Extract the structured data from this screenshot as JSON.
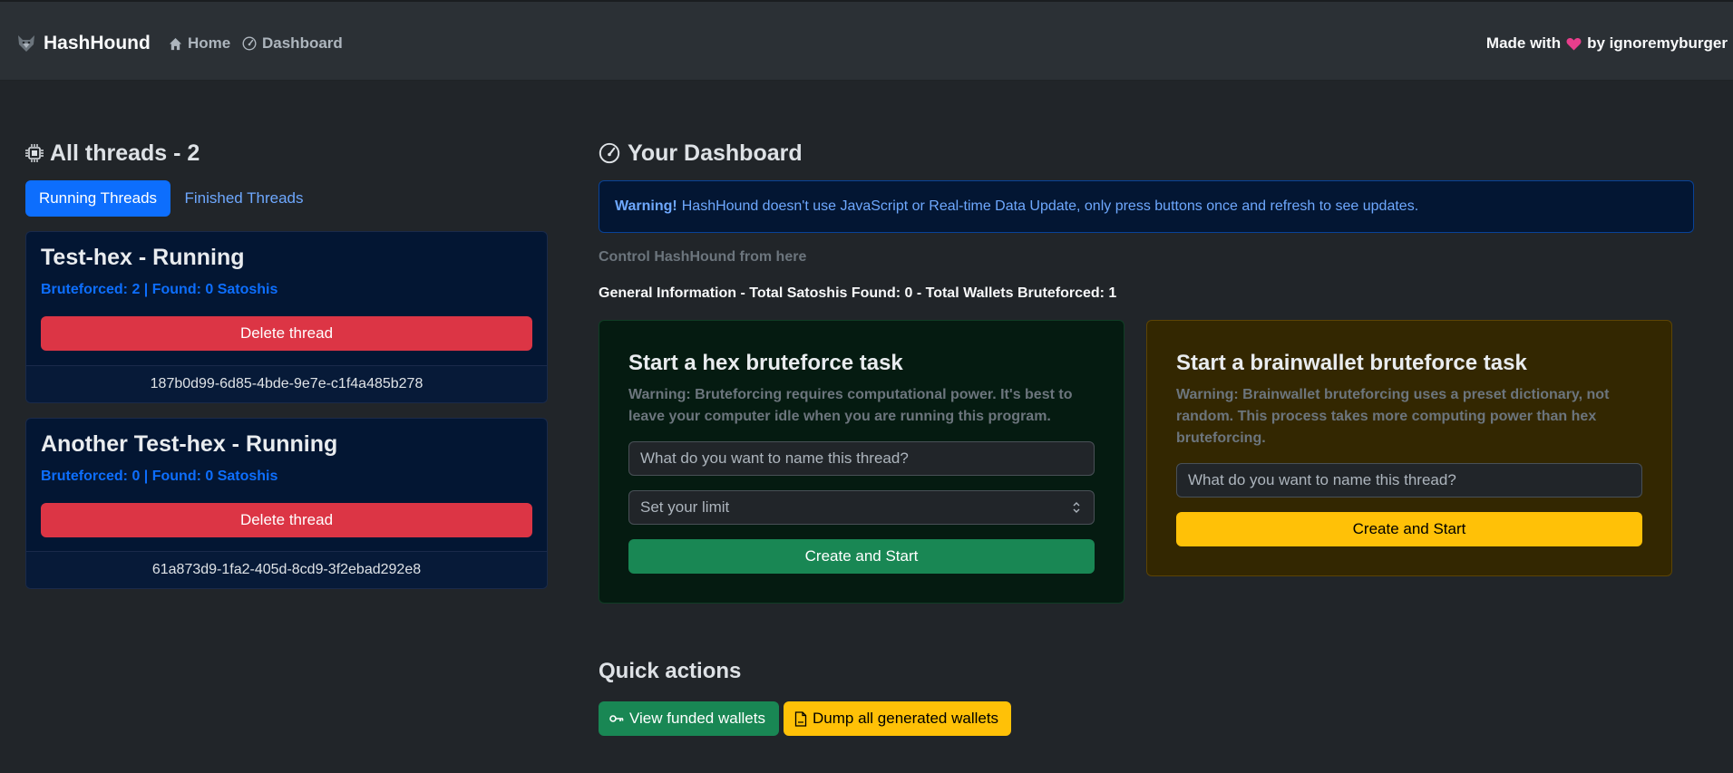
{
  "navbar": {
    "brand": "HashHound",
    "brand_icon": "wolf-icon",
    "links": [
      {
        "label": "Home",
        "icon": "house-icon"
      },
      {
        "label": "Dashboard",
        "icon": "speedometer-icon"
      }
    ],
    "made_with_prefix": "Made with",
    "made_with_icon": "heart-icon",
    "made_with_suffix": "by ignoremyburger"
  },
  "threads": {
    "title": "All threads - 2",
    "title_icon": "cpu-icon",
    "tabs": [
      {
        "label": "Running Threads",
        "active": true
      },
      {
        "label": "Finished Threads",
        "active": false
      }
    ],
    "items": [
      {
        "name": "Test-hex - Running",
        "stats": "Bruteforced: 2 | Found: 0 Satoshis",
        "delete_label": "Delete thread",
        "id": "187b0d99-6d85-4bde-9e7e-c1f4a485b278"
      },
      {
        "name": "Another Test-hex - Running",
        "stats": "Bruteforced: 0 | Found: 0 Satoshis",
        "delete_label": "Delete thread",
        "id": "61a873d9-1fa2-405d-8cd9-3f2ebad292e8"
      }
    ]
  },
  "dashboard": {
    "title": "Your Dashboard",
    "title_icon": "speedometer-icon",
    "alert_strong": "Warning!",
    "alert_text": "HashHound doesn't use JavaScript or Real-time Data Update, only press buttons once and refresh to see updates.",
    "control_text": "Control HashHound from here",
    "general_info": "General Information - Total Satoshis Found: 0 - Total Wallets Bruteforced: 1"
  },
  "hex_task": {
    "title": "Start a hex bruteforce task",
    "warning": "Warning: Bruteforcing requires computational power. It's best to leave your computer idle when you are running this program.",
    "name_placeholder": "What do you want to name this thread?",
    "limit_placeholder": "Set your limit",
    "button": "Create and Start"
  },
  "brain_task": {
    "title": "Start a brainwallet bruteforce task",
    "warning": "Warning: Brainwallet bruteforcing uses a preset dictionary, not random. This process takes more computing power than hex bruteforcing.",
    "name_placeholder": "What do you want to name this thread?",
    "button": "Create and Start"
  },
  "quick_actions": {
    "title": "Quick actions",
    "buttons": [
      {
        "label": "View funded wallets",
        "icon": "key-icon"
      },
      {
        "label": "Dump all generated wallets",
        "icon": "file-icon"
      }
    ]
  },
  "colors": {
    "background": "#212529",
    "navbar": "#2b3035",
    "primary": "#0d6efd",
    "danger": "#dc3545",
    "success": "#198754",
    "warning": "#ffc107"
  }
}
